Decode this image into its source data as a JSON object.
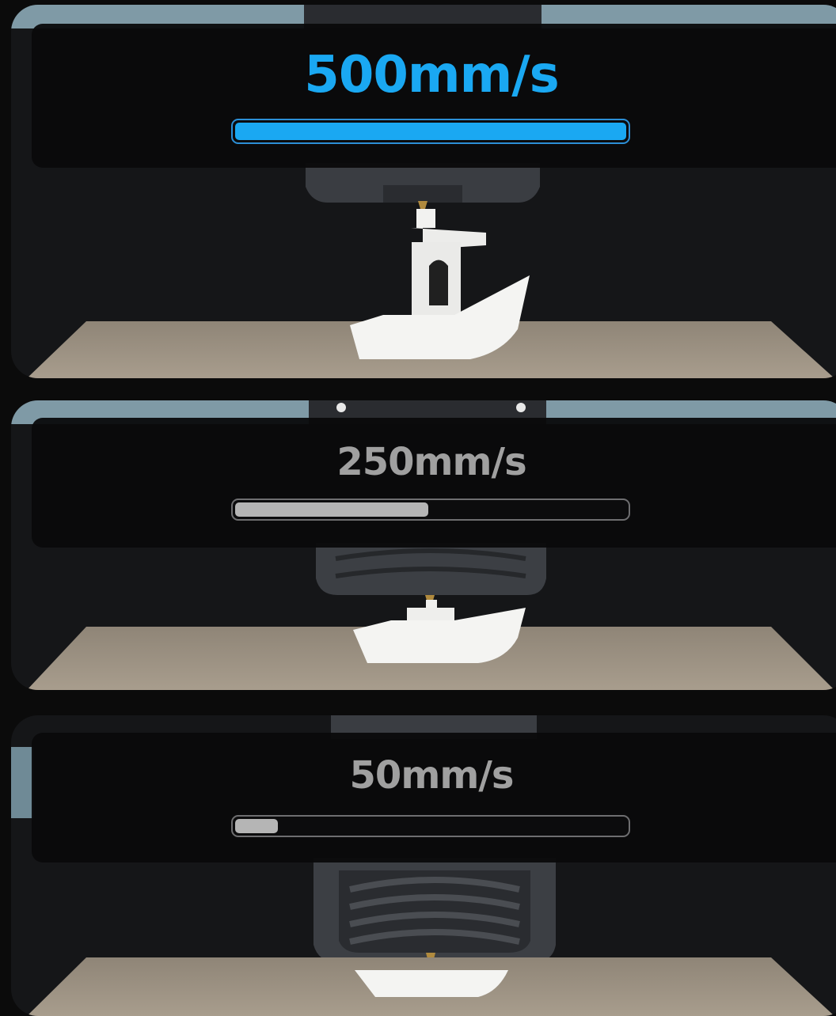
{
  "panels": [
    {
      "speed_label": "500mm/s",
      "progress": 1.0,
      "accent": "#1aa8f2",
      "text_color": "#1aa8f2"
    },
    {
      "speed_label": "250mm/s",
      "progress": 0.5,
      "accent": "#b5b5b5",
      "text_color": "#a0a0a0"
    },
    {
      "speed_label": "50mm/s",
      "progress": 0.12,
      "accent": "#b5b5b5",
      "text_color": "#a0a0a0"
    }
  ]
}
